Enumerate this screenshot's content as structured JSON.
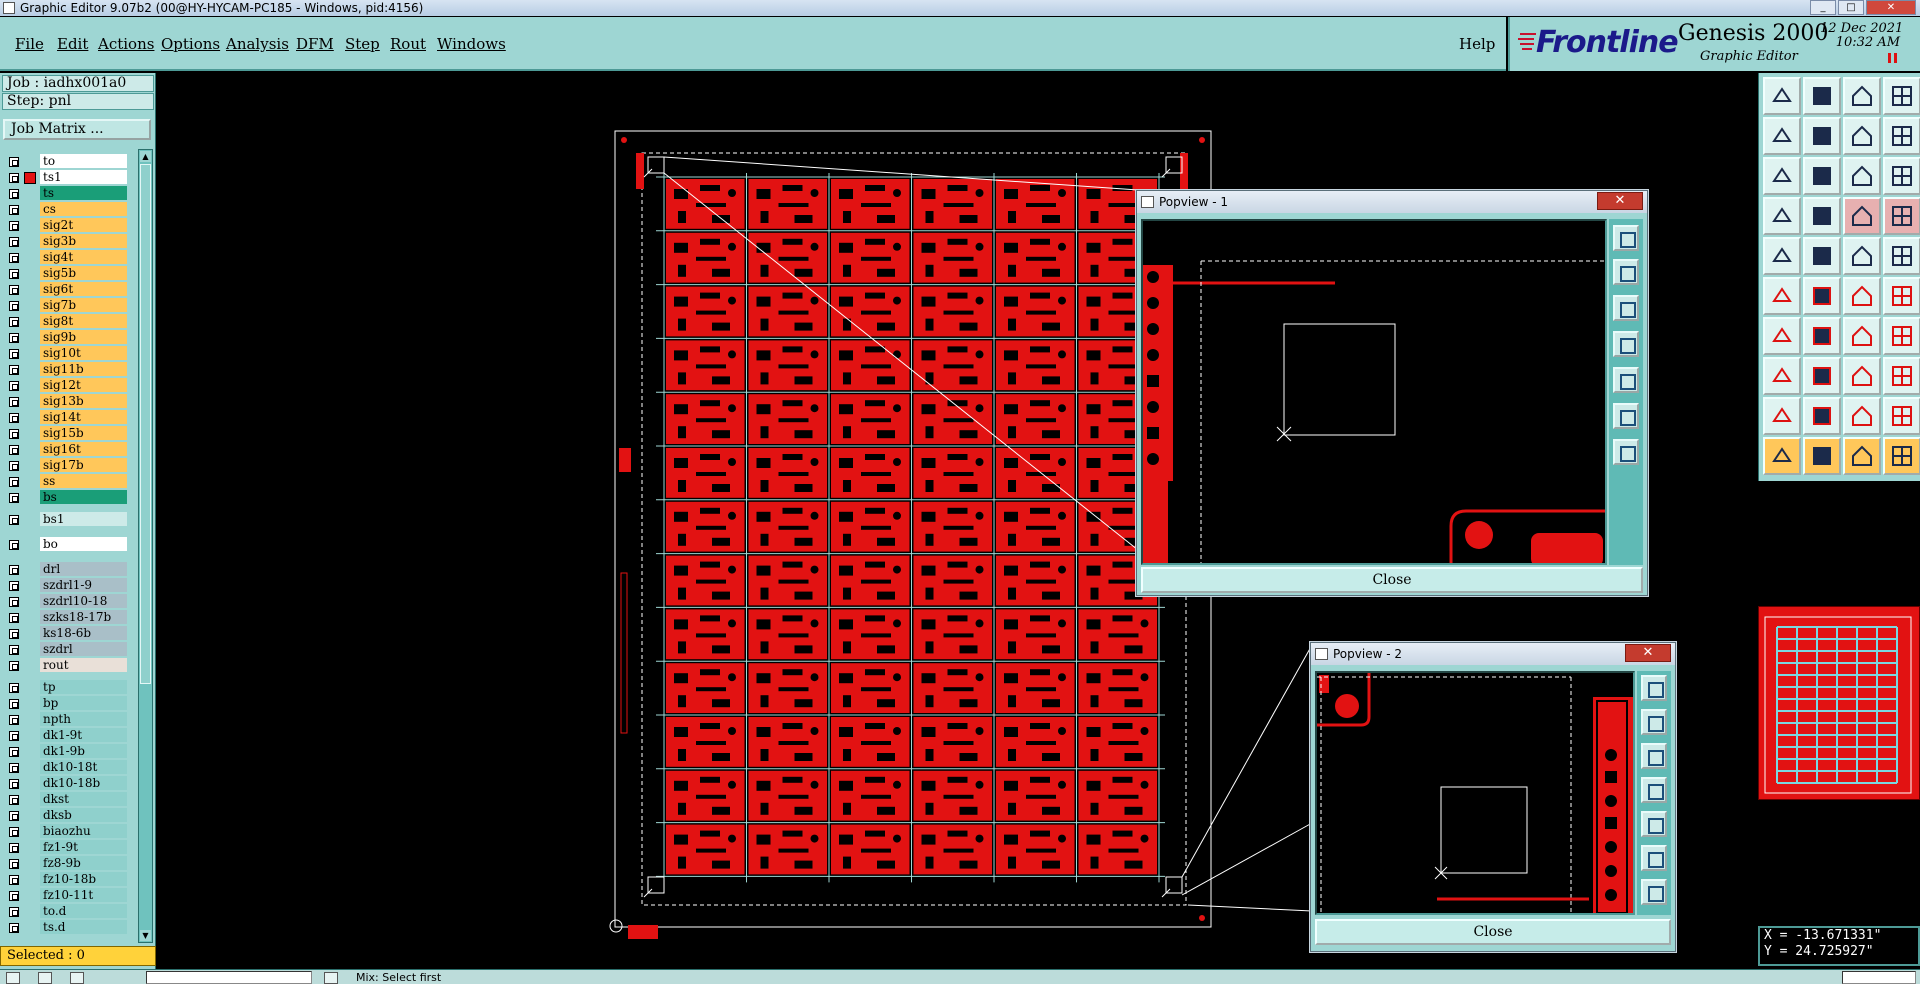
{
  "window": {
    "title": "Graphic Editor 9.07b2 (00@HY-HYCAM-PC185 - Windows, pid:4156)"
  },
  "menu": {
    "items": [
      "File",
      "Edit",
      "Actions",
      "Options",
      "Analysis",
      "DFM",
      "Step",
      "Rout",
      "Windows"
    ],
    "help": "Help"
  },
  "brand": {
    "logo": "Frontline",
    "product": "Genesis 2000",
    "subtitle": "Graphic Editor",
    "date": "12 Dec 2021",
    "time": "10:32 AM"
  },
  "job": {
    "job_line": "Job : iadhx001a0",
    "step_line": "Step: pnl",
    "job_matrix_button": "Job Matrix ..."
  },
  "layers": [
    {
      "name": "to",
      "color": "#ffffff"
    },
    {
      "name": "ts1",
      "color": "#ffffff",
      "active": true
    },
    {
      "name": "ts",
      "color": "#1a9e78"
    },
    {
      "name": "cs",
      "color": "#ffc75a"
    },
    {
      "name": "sig2t",
      "color": "#ffc75a"
    },
    {
      "name": "sig3b",
      "color": "#ffc75a"
    },
    {
      "name": "sig4t",
      "color": "#ffc75a"
    },
    {
      "name": "sig5b",
      "color": "#ffc75a"
    },
    {
      "name": "sig6t",
      "color": "#ffc75a"
    },
    {
      "name": "sig7b",
      "color": "#ffc75a"
    },
    {
      "name": "sig8t",
      "color": "#ffc75a"
    },
    {
      "name": "sig9b",
      "color": "#ffc75a"
    },
    {
      "name": "sig10t",
      "color": "#ffc75a"
    },
    {
      "name": "sig11b",
      "color": "#ffc75a"
    },
    {
      "name": "sig12t",
      "color": "#ffc75a"
    },
    {
      "name": "sig13b",
      "color": "#ffc75a"
    },
    {
      "name": "sig14t",
      "color": "#ffc75a"
    },
    {
      "name": "sig15b",
      "color": "#ffc75a"
    },
    {
      "name": "sig16t",
      "color": "#ffc75a"
    },
    {
      "name": "sig17b",
      "color": "#ffc75a"
    },
    {
      "name": "ss",
      "color": "#ffc75a"
    },
    {
      "name": "bs",
      "color": "#1a9e78"
    },
    {
      "name": "bs1",
      "color": "#cdeae8",
      "gap": true
    },
    {
      "name": "bo",
      "color": "#ffffff",
      "gap": true
    },
    {
      "name": "drl",
      "color": "#a9bfc8",
      "gap": true
    },
    {
      "name": "szdrl1-9",
      "color": "#a9bfc8"
    },
    {
      "name": "szdrl10-18",
      "color": "#a9bfc8"
    },
    {
      "name": "szks18-17b",
      "color": "#a9bfc8"
    },
    {
      "name": "ks18-6b",
      "color": "#a9bfc8"
    },
    {
      "name": "szdrl",
      "color": "#a9bfc8"
    },
    {
      "name": "rout",
      "color": "#e9e0d8"
    },
    {
      "name": "tp",
      "color": "#8fd0cc",
      "gap": true
    },
    {
      "name": "bp",
      "color": "#8fd0cc"
    },
    {
      "name": "npth",
      "color": "#8fd0cc"
    },
    {
      "name": "dk1-9t",
      "color": "#8fd0cc"
    },
    {
      "name": "dk1-9b",
      "color": "#8fd0cc"
    },
    {
      "name": "dk10-18t",
      "color": "#8fd0cc"
    },
    {
      "name": "dk10-18b",
      "color": "#8fd0cc"
    },
    {
      "name": "dkst",
      "color": "#8fd0cc"
    },
    {
      "name": "dksb",
      "color": "#8fd0cc"
    },
    {
      "name": "biaozhu",
      "color": "#8fd0cc"
    },
    {
      "name": "fz1-9t",
      "color": "#8fd0cc"
    },
    {
      "name": "fz8-9b",
      "color": "#8fd0cc"
    },
    {
      "name": "fz10-18b",
      "color": "#8fd0cc"
    },
    {
      "name": "fz10-11t",
      "color": "#8fd0cc"
    },
    {
      "name": "to.d",
      "color": "#8fd0cc"
    },
    {
      "name": "ts.d",
      "color": "#8fd0cc"
    }
  ],
  "selected": "Selected : 0",
  "popview1": {
    "title": "Popview - 1",
    "close_label": "Close",
    "close_x": "✕"
  },
  "popview2": {
    "title": "Popview - 2",
    "close_label": "Close",
    "close_x": "✕"
  },
  "coords": {
    "x": "X = -13.671331\"",
    "y": "Y = 24.725927\""
  },
  "status": {
    "text": "Mix: Select first"
  },
  "colors": {
    "panel": "#9ed6d3",
    "copper": "#e21212",
    "outline": "#ffffff"
  }
}
